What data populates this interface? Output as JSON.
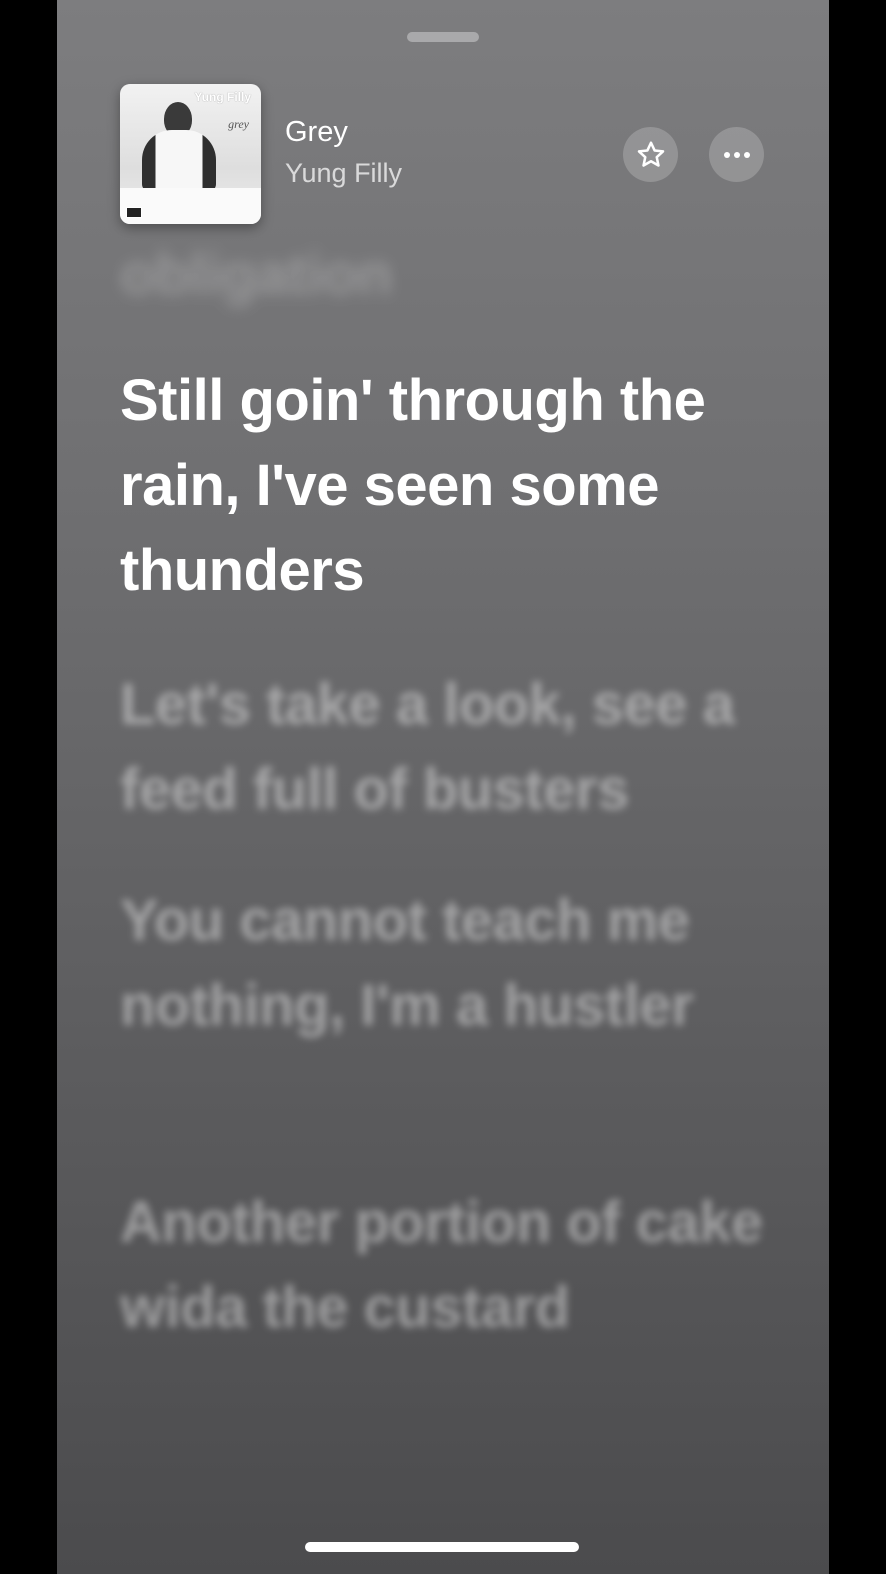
{
  "now_playing": {
    "title": "Grey",
    "artist": "Yung Filly",
    "artwork": {
      "artist_text": "Yung Filly",
      "album_text": "grey"
    }
  },
  "actions": {
    "favorite_icon": "star-icon",
    "more_icon": "ellipsis-icon"
  },
  "lyrics": {
    "previous": "obligation",
    "current": "Still goin' through the rain, I've seen some thunders",
    "next": [
      "Let's take a look, see a feed full of busters",
      "You cannot teach me nothing, I'm a hustler",
      "Another portion of cake wida the custard"
    ]
  },
  "colors": {
    "background_top": "#7d7d7f",
    "background_bottom": "#4b4b4d",
    "active_lyric": "#ffffff"
  }
}
